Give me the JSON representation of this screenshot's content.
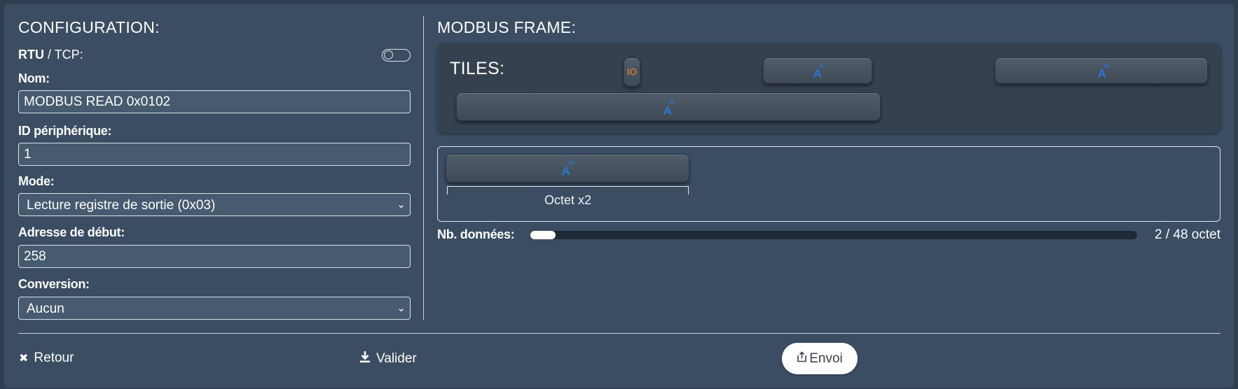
{
  "config": {
    "title": "CONFIGURATION:",
    "protocol": {
      "rtu": "RTU",
      "separator": " / ",
      "tcp": "TCP:",
      "toggle_on": false
    },
    "name": {
      "label": "Nom:",
      "value": "MODBUS READ 0x0102"
    },
    "device_id": {
      "label": "ID périphérique:",
      "value": "1"
    },
    "mode": {
      "label": "Mode:",
      "selected": "Lecture registre de sortie (0x03)"
    },
    "start_address": {
      "label": "Adresse de début:",
      "value": "258"
    },
    "conversion": {
      "label": "Conversion:",
      "selected": "Aucun"
    }
  },
  "frame": {
    "title": "MODBUS FRAME:",
    "tiles_label": "TILES:",
    "tiles": [
      {
        "kind": "io",
        "label": "IO"
      },
      {
        "kind": "A",
        "label": "A",
        "bits": "8"
      },
      {
        "kind": "A",
        "label": "A",
        "bits": "48"
      },
      {
        "kind": "A",
        "label": "A",
        "bits": "32"
      }
    ],
    "slots": [
      {
        "label": "A",
        "bits": "16",
        "caption": "Octet x2"
      }
    ],
    "nb_data": {
      "label": "Nb. données:",
      "used": 2,
      "max": 48,
      "text": "2 / 48 octet"
    }
  },
  "footer": {
    "back_icon": "✖",
    "back": "Retour",
    "validate_icon": "download-icon",
    "validate": "Valider",
    "send_icon": "upload-icon",
    "send": "Envoi"
  },
  "colors": {
    "accent_blue": "#1f83ff",
    "io_orange": "#ff8a2a",
    "panel": "#3a4d63"
  }
}
